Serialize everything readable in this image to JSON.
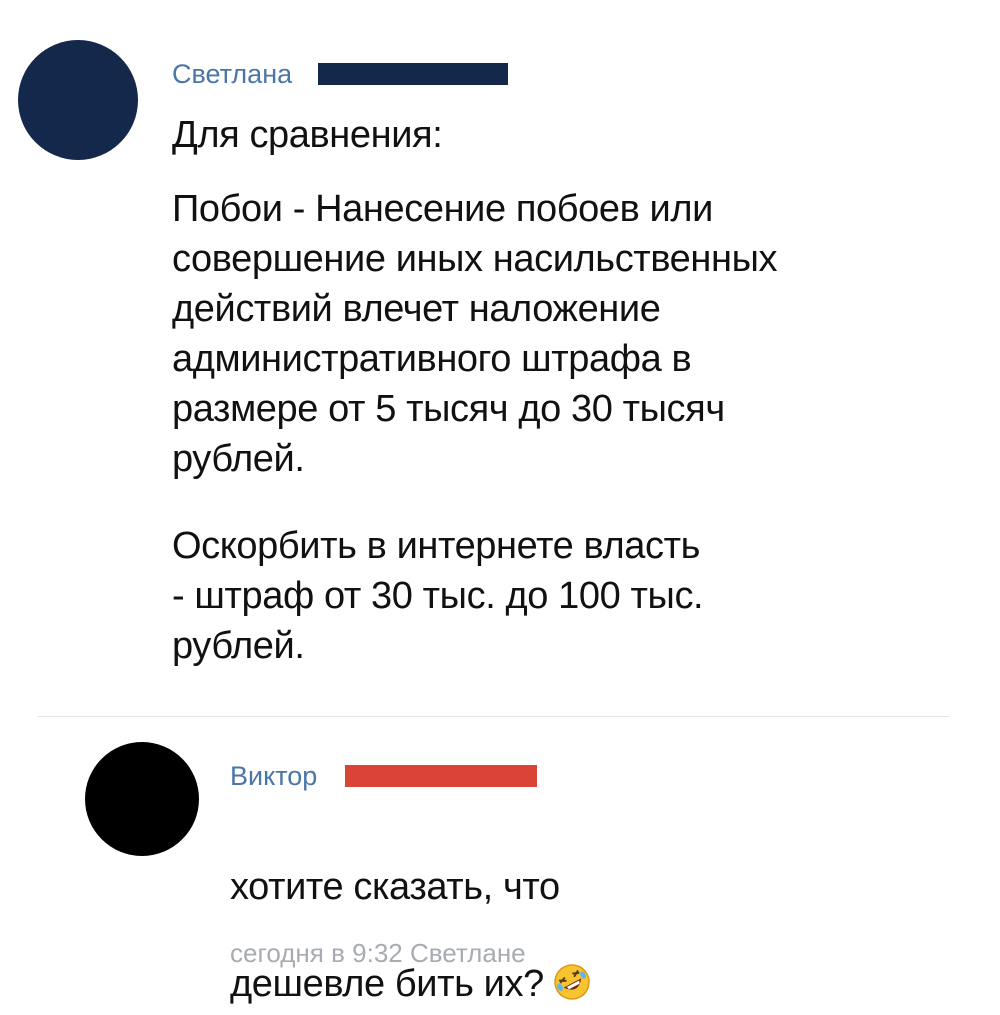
{
  "comments": [
    {
      "author": "Светлана",
      "avatar_color": "#14284b",
      "redaction_color": "#14284b",
      "name_color": "#4a76a8",
      "paragraphs": [
        "Для сравнения:",
        "Побои - Нанесение побоев или\nсовершение иных насильственных\nдействий влечет наложение\nадминистративного штрафа в\nразмере от 5 тысяч до 30 тысяч\nрублей.",
        "Оскорбить в интернете власть\n- штраф от 30 тыс. до 100 тыс.\nрублей."
      ]
    },
    {
      "author": "Виктор",
      "avatar_color": "#000000",
      "redaction_color": "#d94436",
      "name_color": "#4a76a8",
      "text": "хотите сказать,  что\nдешевле бить их?",
      "emoji_icon": "rolling-on-floor-laughing-emoji",
      "meta": "сегодня в 9:32 Светлане"
    }
  ]
}
